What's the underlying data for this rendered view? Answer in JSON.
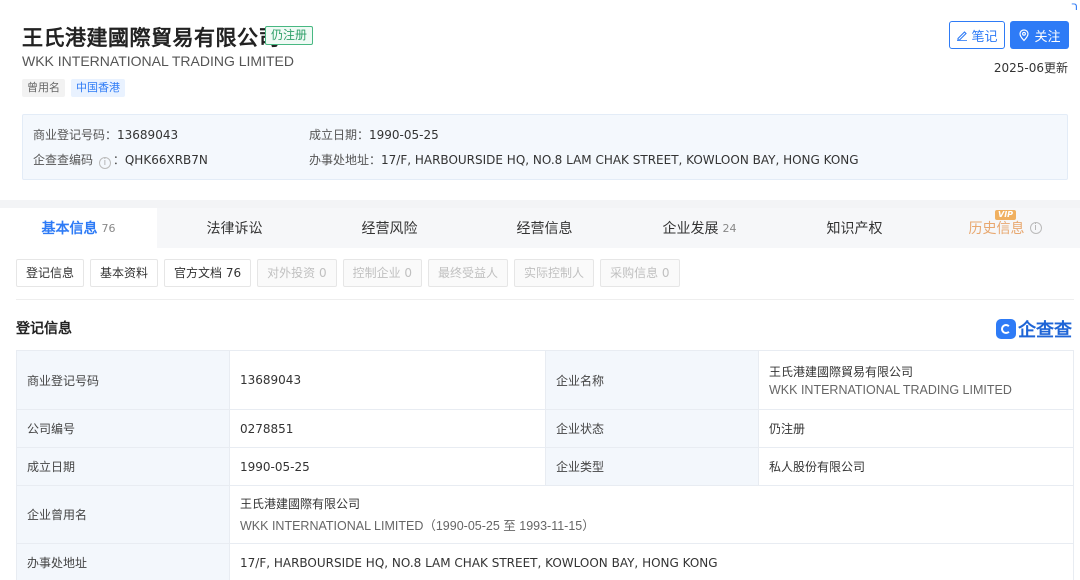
{
  "header": {
    "corner_mark": "ר",
    "company_name": "王氏港建國際貿易有限公司",
    "status": "仍注册",
    "company_name_en": "WKK INTERNATIONAL TRADING LIMITED",
    "tags": [
      "曾用名",
      "中国香港"
    ],
    "note_button": "笔记",
    "follow_button": "关注",
    "update_time": "2025-06更新",
    "info": {
      "reg_no_label": "商业登记号码：",
      "reg_no": "13689043",
      "qcc_code_label": "企查查编码",
      "qcc_code": "QHK66XRB7N",
      "founded_label": "成立日期：",
      "founded": "1990-05-25",
      "address_label": "办事处地址：",
      "address": "17/F, HARBOURSIDE HQ, NO.8 LAM CHAK STREET, KOWLOON BAY, HONG KONG"
    }
  },
  "main_tabs": [
    {
      "label": "基本信息",
      "count": "76"
    },
    {
      "label": "法律诉讼",
      "count": ""
    },
    {
      "label": "经营风险",
      "count": ""
    },
    {
      "label": "经营信息",
      "count": ""
    },
    {
      "label": "企业发展",
      "count": "24"
    },
    {
      "label": "知识产权",
      "count": ""
    },
    {
      "label": "历史信息",
      "count": "",
      "badge": "VIP"
    }
  ],
  "sub_tabs": [
    {
      "label": "登记信息"
    },
    {
      "label": "基本资料"
    },
    {
      "label": "官方文档 76"
    },
    {
      "label": "对外投资 0"
    },
    {
      "label": "控制企业 0"
    },
    {
      "label": "最终受益人"
    },
    {
      "label": "实际控制人"
    },
    {
      "label": "采购信息 0"
    }
  ],
  "section": {
    "title": "登记信息",
    "logo_text": "企查查"
  },
  "registration_table": {
    "reg_no_label": "商业登记号码",
    "reg_no": "13689043",
    "name_label": "企业名称",
    "name_cn": "王氏港建國際貿易有限公司",
    "name_en": "WKK INTERNATIONAL TRADING LIMITED",
    "company_no_label": "公司编号",
    "company_no": "0278851",
    "status_label": "企业状态",
    "status": "仍注册",
    "founded_label": "成立日期",
    "founded": "1990-05-25",
    "type_label": "企业类型",
    "type": "私人股份有限公司",
    "former_name_label": "企业曾用名",
    "former_name_cn": "王氏港建國際有限公司",
    "former_name_en": "WKK INTERNATIONAL LIMITED（1990-05-25 至 1993-11-15）",
    "address_label": "办事处地址",
    "address": "17/F, HARBOURSIDE HQ, NO.8 LAM CHAK STREET, KOWLOON BAY, HONG KONG"
  },
  "colors": {
    "accent": "#2e7bf6",
    "status_green": "#2e9f68",
    "vip": "#e8a870",
    "label_bg": "#f3f7fc"
  }
}
